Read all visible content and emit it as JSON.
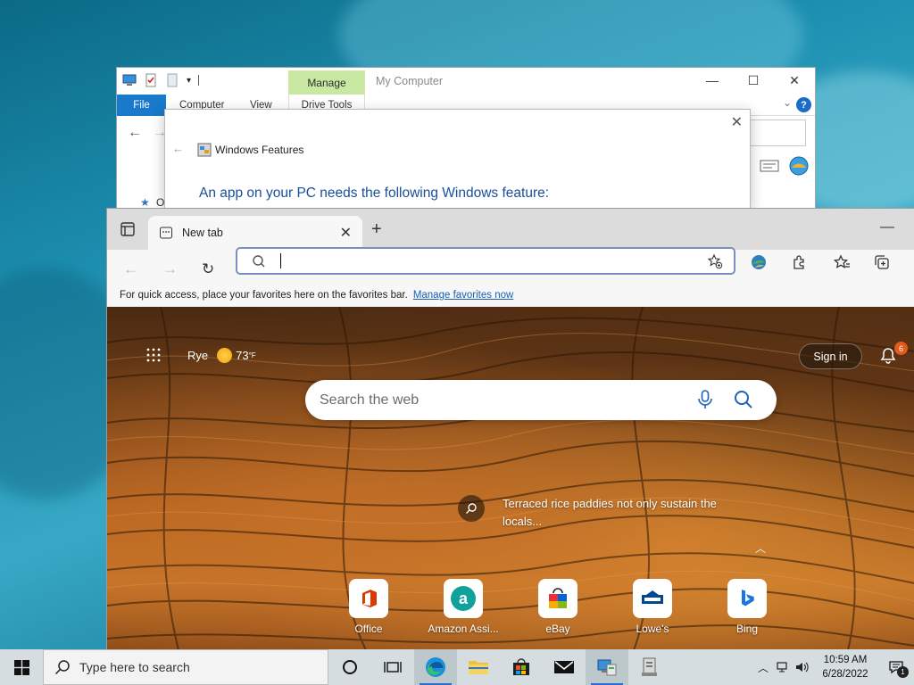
{
  "explorer": {
    "manage_label": "Manage",
    "window_title": "My Computer",
    "tabs": {
      "file": "File",
      "computer": "Computer",
      "view": "View",
      "drive_tools": "Drive Tools"
    },
    "help": "?",
    "nav_item_initial": "O"
  },
  "dialog": {
    "title": "Windows Features",
    "heading": "An app on your PC needs the following Windows feature:"
  },
  "browser": {
    "tab_title": "New tab",
    "favorites_bar_text": "For quick access, place your favorites here on the favorites bar.",
    "favorites_link": "Manage favorites now",
    "new_tab_page": {
      "location": "Rye",
      "temperature": "73",
      "temp_unit": "°F",
      "sign_in": "Sign in",
      "notification_count": "6",
      "search_placeholder": "Search the web",
      "caption": "Terraced rice paddies not only sustain the locals...",
      "quick_links": [
        {
          "label": "Office",
          "icon": "office-icon"
        },
        {
          "label": "Amazon Assi...",
          "icon": "amazon-icon"
        },
        {
          "label": "eBay",
          "icon": "ebay-icon"
        },
        {
          "label": "Lowe's",
          "icon": "lowes-icon"
        },
        {
          "label": "Bing",
          "icon": "bing-icon"
        }
      ]
    }
  },
  "taskbar": {
    "search_placeholder": "Type here to search",
    "time": "10:59 AM",
    "date": "6/28/2022",
    "notification_count": "1"
  },
  "colors": {
    "file_tab": "#1979ca",
    "manage_tab": "#c9e8a4",
    "dialog_heading": "#1a4e9a",
    "link": "#1a5fb4",
    "badge": "#e25a1c"
  }
}
